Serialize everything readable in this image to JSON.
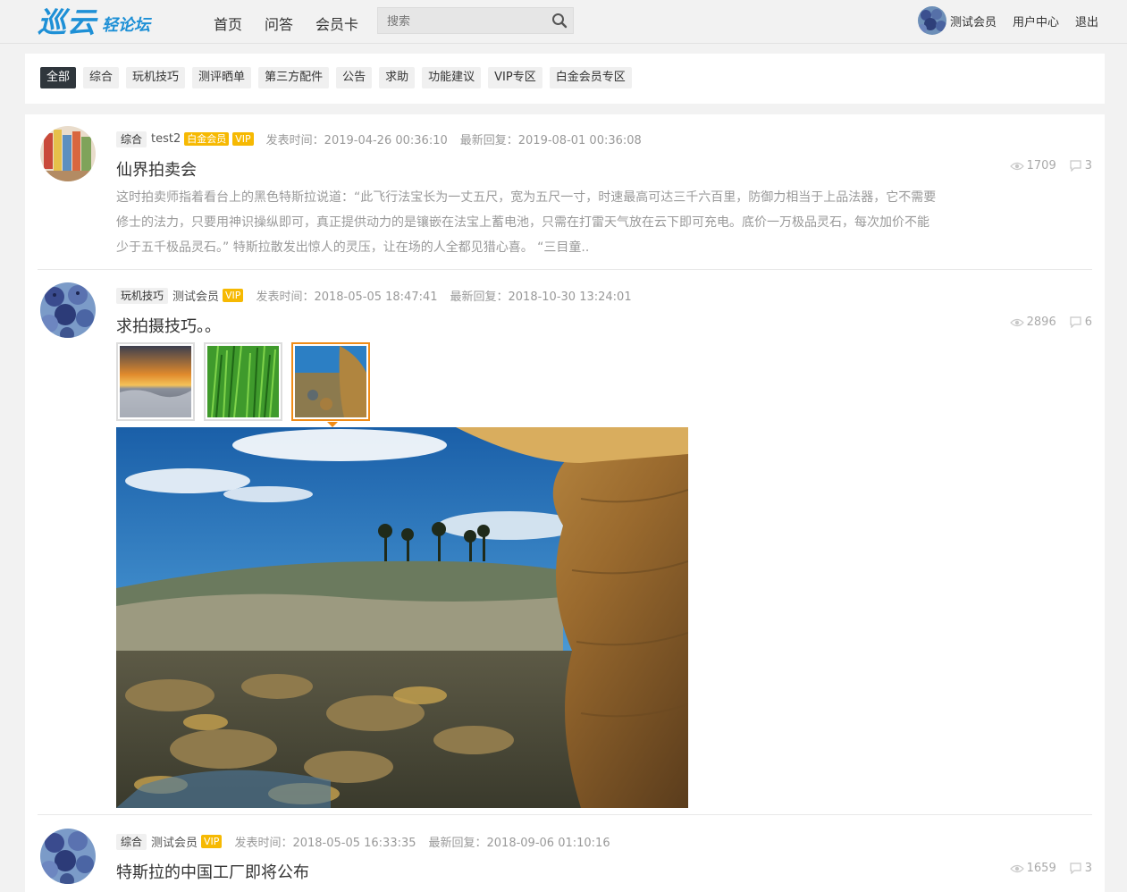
{
  "header": {
    "logo_main": "巡云",
    "logo_sub": "轻论坛",
    "nav": [
      "首页",
      "问答",
      "会员卡"
    ],
    "search_placeholder": "搜索",
    "user_name": "测试会员",
    "user_center": "用户中心",
    "logout": "退出"
  },
  "categories": {
    "items": [
      "全部",
      "综合",
      "玩机技巧",
      "测评晒单",
      "第三方配件",
      "公告",
      "求助",
      "功能建议",
      "VIP专区",
      "白金会员专区"
    ],
    "active": "全部"
  },
  "posts": [
    {
      "category": "综合",
      "author": "test2",
      "badges": [
        "白金会员",
        "VIP"
      ],
      "post_time": "发表时间：2019-04-26 00:36:10",
      "last_reply": "最新回复：2019-08-01 00:36:08",
      "title": "仙界拍卖会",
      "excerpt": "这时拍卖师指着看台上的黑色特斯拉说道：“此飞行法宝长为一丈五尺，宽为五尺一寸，时速最高可达三千六百里，防御力相当于上品法器，它不需要修士的法力，只要用神识操纵即可，真正提供动力的是镶嵌在法宝上蓄电池，只需在打雷天气放在云下即可充电。底价一万极品灵石，每次加价不能少于五千极品灵石。” 特斯拉散发出惊人的灵压，让在场的人全都见猎心喜。 “三目童..",
      "views": "1709",
      "comments": "3"
    },
    {
      "category": "玩机技巧",
      "author": "测试会员",
      "badges": [
        "VIP"
      ],
      "post_time": "发表时间：2018-05-05 18:47:41",
      "last_reply": "最新回复：2018-10-30 13:24:01",
      "title": "求拍摄技巧。。",
      "views": "2896",
      "comments": "6",
      "selected_thumb": 3
    },
    {
      "category": "综合",
      "author": "测试会员",
      "badges": [
        "VIP"
      ],
      "post_time": "发表时间：2018-05-05 16:33:35",
      "last_reply": "最新回复：2018-09-06 01:10:16",
      "title": "特斯拉的中国工厂即将公布",
      "views": "1659",
      "comments": "3"
    }
  ],
  "colors": {
    "brand": "#1e90d6",
    "badge": "#f6b902",
    "active_category": "#2f363c",
    "selected_thumb_border": "#f08c17"
  }
}
